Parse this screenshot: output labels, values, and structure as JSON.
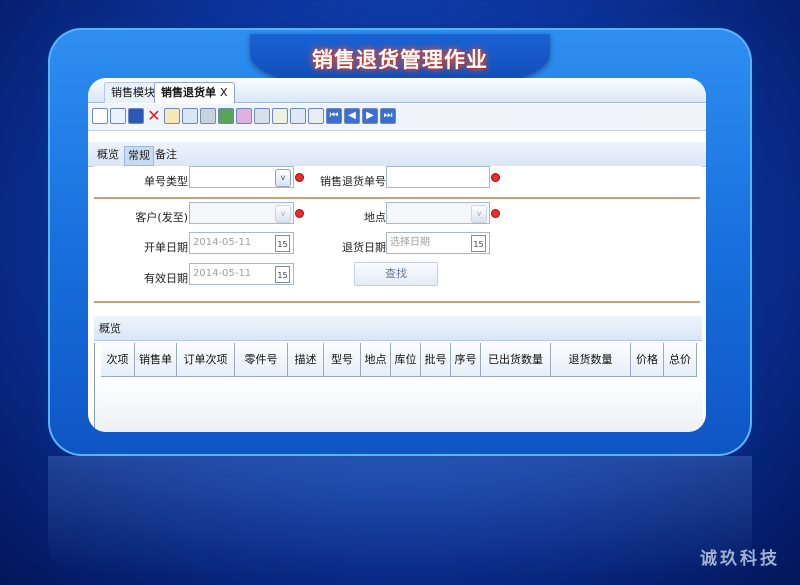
{
  "title": "销售退货管理作业",
  "tabs": [
    {
      "label": "销售模块"
    },
    {
      "label": "销售退货单",
      "close": "X"
    }
  ],
  "toolbar_icons": [
    "new-doc-icon",
    "copy-icon",
    "save-icon",
    "delete-icon",
    "edit-icon",
    "print-icon",
    "attach-icon",
    "excel-icon",
    "calendar-icon",
    "audit-icon",
    "export-icon",
    "import-icon",
    "report-icon",
    "first-icon",
    "prev-icon",
    "next-icon",
    "last-icon"
  ],
  "subtabs": [
    "概览",
    "常规",
    "备注"
  ],
  "form": {
    "doc_type_label": "单号类型",
    "doc_type_value": "",
    "return_no_label": "销售退货单号",
    "return_no_value": "",
    "customer_label": "客户(发至)",
    "customer_value": "",
    "location_label": "地点",
    "location_value": "",
    "open_date_label": "开单日期",
    "open_date_value": "2014-05-11",
    "return_date_label": "退货日期",
    "return_date_placeholder": "选择日期",
    "valid_date_label": "有效日期",
    "valid_date_value": "2014-05-11",
    "search_button": "查找",
    "calendar_glyph": "15",
    "dropdown_glyph": "v"
  },
  "grid": {
    "tab_label": "概览",
    "columns": [
      "次项",
      "销售单",
      "订单次项",
      "零件号",
      "描述",
      "型号",
      "地点",
      "库位",
      "批号",
      "序号",
      "已出货数量",
      "退货数量",
      "价格",
      "总价"
    ]
  },
  "brand": "诚玖科技"
}
